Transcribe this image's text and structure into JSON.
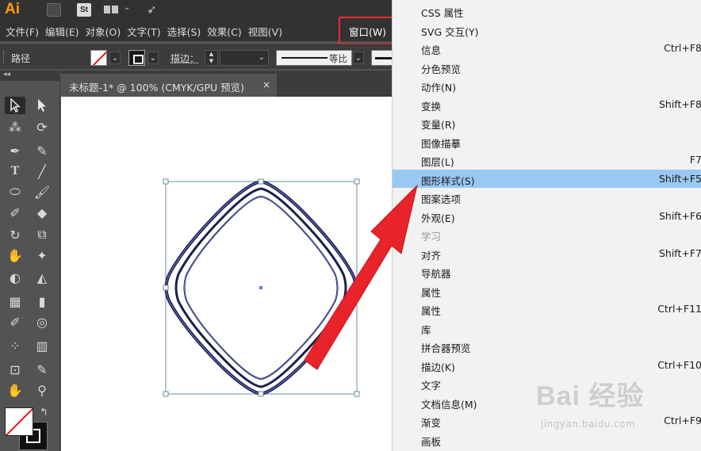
{
  "app": {
    "logo_text": "Ai",
    "bridge_icon": "bridge-icon",
    "stock_label": "St",
    "colors": {
      "accent": "#ff9a00",
      "highlight": "#99c9f3",
      "annotation": "#ff2a2a"
    }
  },
  "menubar": {
    "items": [
      "文件(F)",
      "编辑(E)",
      "对象(O)",
      "文字(T)",
      "选择(S)",
      "效果(C)",
      "视图(V)"
    ],
    "window_menu": "窗口(W)"
  },
  "controlbar": {
    "selection_label": "路径",
    "stroke_label": "描边：",
    "stroke_weight": "",
    "profile_label": "等比"
  },
  "document": {
    "tab_title": "未标题-1* @ 100% (CMYK/GPU 预览)",
    "close_glyph": "×"
  },
  "window_menu_items": [
    {
      "label": "CSS 属性",
      "shortcut": ""
    },
    {
      "label": "SVG 交互(Y)",
      "shortcut": ""
    },
    {
      "label": "信息",
      "shortcut": "Ctrl+F8"
    },
    {
      "label": "分色预览",
      "shortcut": ""
    },
    {
      "label": "动作(N)",
      "shortcut": ""
    },
    {
      "label": "变换",
      "shortcut": "Shift+F8"
    },
    {
      "label": "变量(R)",
      "shortcut": ""
    },
    {
      "label": "图像描摹",
      "shortcut": ""
    },
    {
      "label": "图层(L)",
      "shortcut": "F7"
    },
    {
      "label": "图形样式(S)",
      "shortcut": "Shift+F5",
      "highlighted": true
    },
    {
      "label": "图案选项",
      "shortcut": ""
    },
    {
      "label": "外观(E)",
      "shortcut": "Shift+F6"
    },
    {
      "label": "学习",
      "shortcut": "",
      "disabled": true
    },
    {
      "label": "对齐",
      "shortcut": "Shift+F7"
    },
    {
      "label": "导航器",
      "shortcut": ""
    },
    {
      "label": "属性",
      "shortcut": ""
    },
    {
      "label": "属性",
      "shortcut": "Ctrl+F11"
    },
    {
      "label": "库",
      "shortcut": ""
    },
    {
      "label": "拼合器预览",
      "shortcut": ""
    },
    {
      "label": "描边(K)",
      "shortcut": "Ctrl+F10"
    },
    {
      "label": "文字",
      "shortcut": ""
    },
    {
      "label": "文档信息(M)",
      "shortcut": ""
    },
    {
      "label": "渐变",
      "shortcut": "Ctrl+F9"
    },
    {
      "label": "画板",
      "shortcut": ""
    }
  ],
  "watermark": {
    "logo": "Bai 经验",
    "url": "jingyan.baidu.com"
  },
  "tools": [
    "selection-tool-icon",
    "direct-selection-tool-icon",
    "magic-wand-tool-icon",
    "lasso-tool-icon",
    "pen-tool-icon",
    "curvature-tool-icon",
    "type-tool-icon",
    "line-segment-tool-icon",
    "ellipse-tool-icon",
    "paintbrush-tool-icon",
    "shaper-tool-icon",
    "eraser-tool-icon",
    "rotate-tool-icon",
    "scale-tool-icon",
    "warp-tool-icon",
    "puppet-warp-tool-icon",
    "shape-builder-tool-icon",
    "perspective-grid-tool-icon",
    "mesh-tool-icon",
    "gradient-tool-icon",
    "eyedropper-tool-icon",
    "blend-tool-icon",
    "symbol-sprayer-tool-icon",
    "column-graph-tool-icon",
    "artboard-tool-icon",
    "slice-tool-icon",
    "hand-tool-icon",
    "zoom-tool-icon"
  ]
}
